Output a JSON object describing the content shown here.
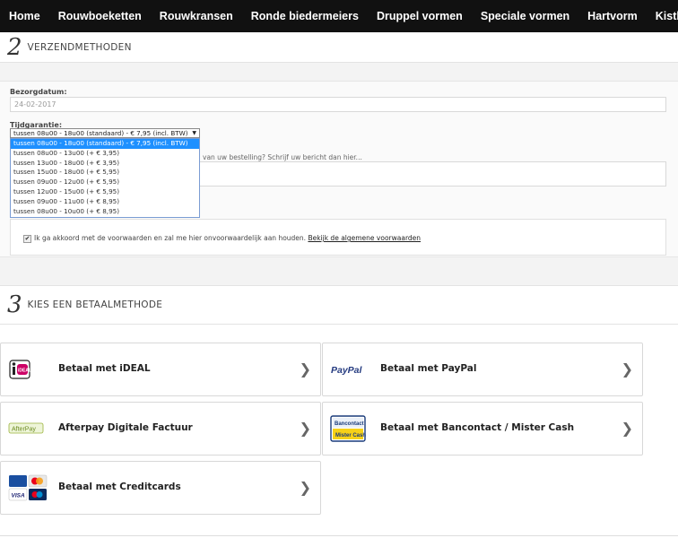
{
  "nav": {
    "items": [
      "Home",
      "Rouwboeketten",
      "Rouwkransen",
      "Ronde biedermeiers",
      "Druppel vormen",
      "Speciale vormen",
      "Hartvorm",
      "Kistbedekking"
    ]
  },
  "step2": {
    "number": "2",
    "title": "VERZENDMETHODEN",
    "delivery_label": "Bezorgdatum:",
    "delivery_value": "24-02-2017",
    "time_label": "Tijdgarantie:",
    "time_selected": "tussen 08u00 - 18u00 (standaard) - € 7,95 (incl. BTW)",
    "time_options": [
      "tussen 08u00 - 18u00 (standaard) - € 7,95 (incl. BTW)",
      "tussen 08u00 - 13u00 (+ € 3,95)",
      "tussen 13u00 - 18u00 (+ € 3,95)",
      "tussen 15u00 - 18u00 (+ € 5,95)",
      "tussen 09u00 - 12u00 (+ € 5,95)",
      "tussen 12u00 - 15u00 (+ € 5,95)",
      "tussen 09u00 - 11u00 (+ € 8,95)",
      "tussen 08u00 - 10u00 (+ € 8,95)"
    ],
    "message_hint": "van uw bestelling? Schrijf uw bericht dan hier...",
    "agree_text": "Ik ga akkoord met de voorwaarden en zal me hier onvoorwaardelijk aan houden.",
    "agree_link": "Bekijk de algemene voorwaarden"
  },
  "step3": {
    "number": "3",
    "title": "KIES EEN BETAALMETHODE",
    "methods": [
      {
        "label": "Betaal met iDEAL",
        "logo": "ideal-logo",
        "logo_text": "iDEAL"
      },
      {
        "label": "Betaal met PayPal",
        "logo": "paypal-logo",
        "logo_text": "PayPal"
      },
      {
        "label": "Afterpay Digitale Factuur",
        "logo": "afterpay-logo",
        "logo_text": "AfterPay"
      },
      {
        "label": "Betaal met Bancontact / Mister Cash",
        "logo": "bancontact-logo",
        "logo_text": "Bancontact Mister Cash"
      },
      {
        "label": "Betaal met Creditcards",
        "logo": "creditcards-logo",
        "logo_text": "VISA"
      }
    ]
  },
  "colors": {
    "nav_bg": "#111111",
    "select_highlight": "#1e90ff",
    "paypal_blue": "#253b80",
    "ideal_pink": "#cc0066"
  }
}
